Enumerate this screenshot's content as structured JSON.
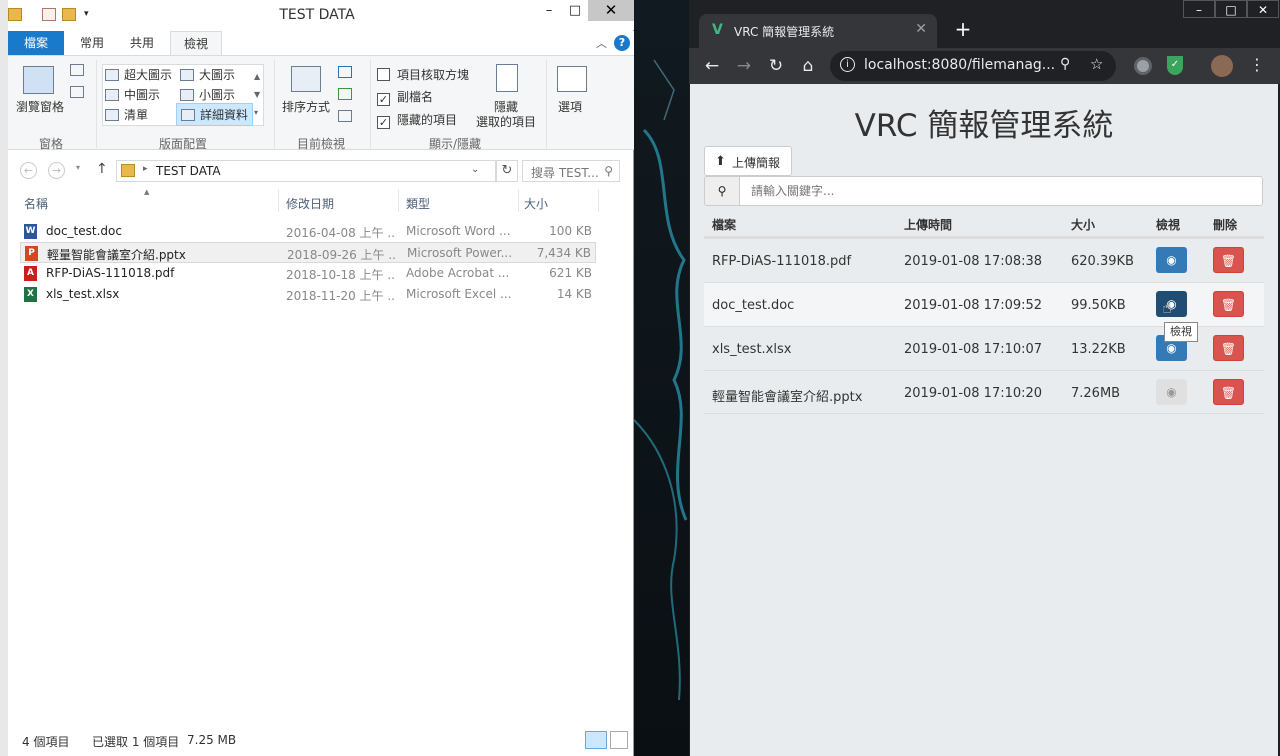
{
  "explorer": {
    "title": "TEST DATA",
    "tabs": [
      "檔案",
      "常用",
      "共用",
      "檢視"
    ],
    "ribbon": {
      "pane_label": "瀏覽窗格",
      "group_panes": "窗格",
      "layouts": [
        "超大圖示",
        "大圖示",
        "中圖示",
        "小圖示",
        "清單",
        "詳細資料"
      ],
      "group_layout": "版面配置",
      "sort_label": "排序方式",
      "group_current": "目前檢視",
      "check_items": "項目核取方塊",
      "check_ext": "副檔名",
      "check_hidden": "隱藏的項目",
      "hide_selected": "隱藏",
      "hide_selected2": "選取的項目",
      "group_showhide": "顯示/隱藏",
      "options": "選項"
    },
    "address": "TEST DATA",
    "search_placeholder": "搜尋 TEST...",
    "columns": [
      "名稱",
      "修改日期",
      "類型",
      "大小"
    ],
    "files": [
      {
        "name": "doc_test.doc",
        "date": "2016-04-08 上午 ...",
        "type": "Microsoft Word ...",
        "size": "100 KB",
        "icon": "word-icon"
      },
      {
        "name": "輕量智能會議室介紹.pptx",
        "date": "2018-09-26 上午 ...",
        "type": "Microsoft Power...",
        "size": "7,434 KB",
        "icon": "powerpoint-icon"
      },
      {
        "name": "RFP-DiAS-111018.pdf",
        "date": "2018-10-18 上午 ...",
        "type": "Adobe Acrobat ...",
        "size": "621 KB",
        "icon": "pdf-icon"
      },
      {
        "name": "xls_test.xlsx",
        "date": "2018-11-20 上午 ...",
        "type": "Microsoft Excel ...",
        "size": "14 KB",
        "icon": "excel-icon"
      }
    ],
    "status_count": "4 個項目",
    "status_selected": "已選取 1 個項目",
    "status_size": "7.25 MB"
  },
  "browser": {
    "tab_title": "VRC 簡報管理系統",
    "url": "localhost:8080/filemanag...",
    "page": {
      "title": "VRC 簡報管理系統",
      "upload_label": "上傳簡報",
      "search_placeholder": "請輸入關鍵字...",
      "headers": [
        "檔案",
        "上傳時間",
        "大小",
        "檢視",
        "刪除"
      ],
      "rows": [
        {
          "file": "RFP-DiAS-111018.pdf",
          "time": "2019-01-08 17:08:38",
          "size": "620.39KB"
        },
        {
          "file": "doc_test.doc",
          "time": "2019-01-08 17:09:52",
          "size": "99.50KB"
        },
        {
          "file": "xls_test.xlsx",
          "time": "2019-01-08 17:10:07",
          "size": "13.22KB"
        },
        {
          "file": "輕量智能會議室介紹.pptx",
          "time": "2019-01-08 17:10:20",
          "size": "7.26MB"
        }
      ],
      "tooltip": "檢視"
    }
  },
  "colors": {
    "accent": "#1979ca",
    "view_btn": "#337ab7",
    "delete_btn": "#d9534f"
  }
}
